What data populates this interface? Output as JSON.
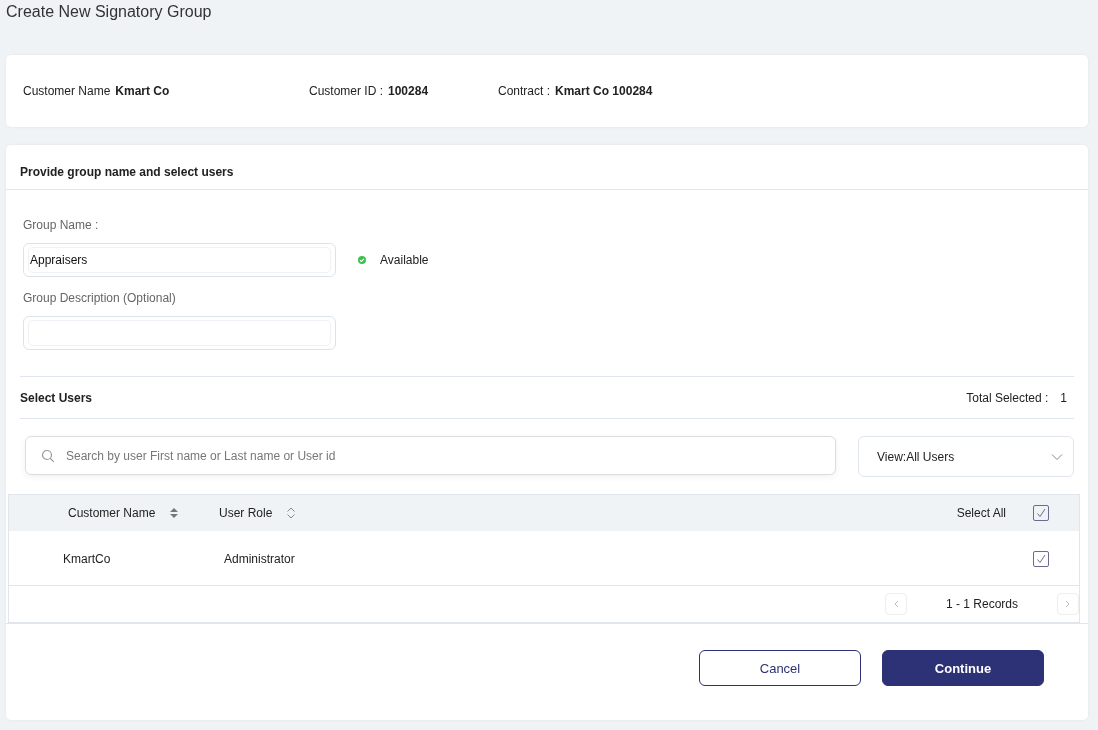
{
  "page_title": "Create New Signatory Group",
  "customer": [
    {
      "label": "Customer Name",
      "value": "Kmart Co"
    },
    {
      "label": "Customer ID :",
      "value": "100284"
    },
    {
      "label": "Contract :",
      "value": "Kmart Co 100284"
    }
  ],
  "form": {
    "heading": "Provide group name and select users",
    "group_name": {
      "label": "Group Name :",
      "value": "Appraisers",
      "status": "Available",
      "available": true
    },
    "group_description": {
      "label": "Group Description (Optional)"
    }
  },
  "select_users": {
    "heading": "Select Users",
    "total_label": "Total Selected :",
    "total": "1",
    "search": {
      "placeholder": "Search by user First name or Last name or User id"
    },
    "view_filter": "View:All Users"
  },
  "table": {
    "columns": [
      {
        "label": "Customer Name",
        "sorted": true
      },
      {
        "label": "User Role",
        "sorted": false
      }
    ],
    "select_all": {
      "label": "Select All",
      "checked": true
    },
    "rows": [
      {
        "customer_name": "KmartCo",
        "user_role": "Administrator",
        "checked": true
      }
    ],
    "records": "1 - 1 Records"
  },
  "buttons": {
    "cancel": "Cancel",
    "continue": "Continue"
  }
}
